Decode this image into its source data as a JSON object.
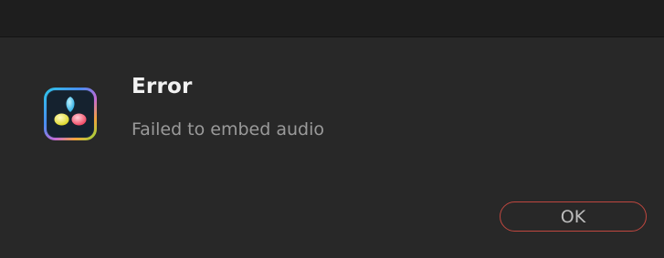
{
  "dialog": {
    "title": "Error",
    "message": "Failed to embed audio",
    "ok_label": "OK",
    "icon": "davinci-resolve-icon"
  },
  "colors": {
    "background": "#282828",
    "title_strip": "#1e1e1e",
    "ok_border": "#c0473f"
  }
}
